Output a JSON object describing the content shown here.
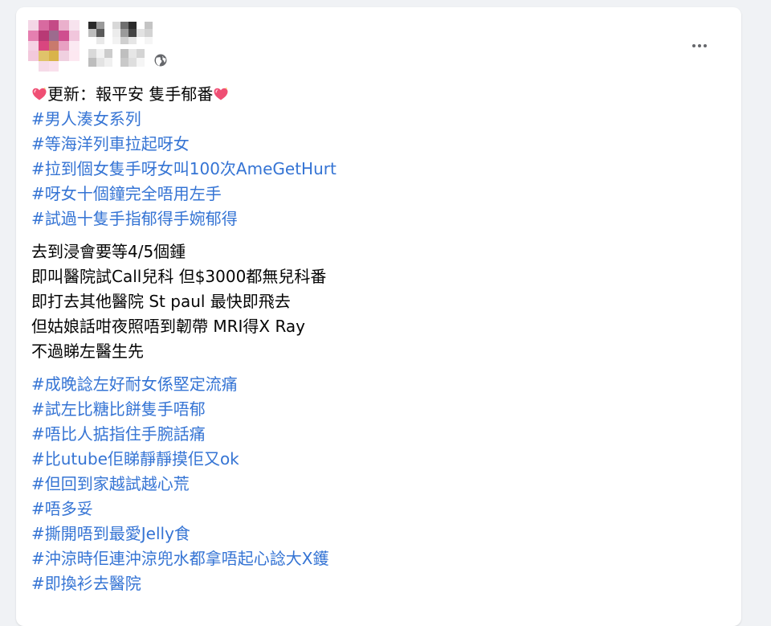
{
  "post": {
    "header": {
      "avatar_colors": [
        "#f4d7e6",
        "#d86aa0",
        "#c44a86",
        "#eab0cc",
        "#f7e3ee",
        "#e57fb0",
        "#b83a75",
        "#9c6b8e",
        "#cf4f8f",
        "#f1c6dc",
        "#f5d2e4",
        "#d9467f",
        "#c97a6d",
        "#e8a0c2",
        "#fbe9f2",
        "#f3c9dc",
        "#e0c36a",
        "#d9b44a",
        "#f0d0e0",
        "#fde8f1",
        "#ffffff",
        "#f6dbe8",
        "#f9e0ec",
        "#ffffff",
        "#ffffff"
      ],
      "name_colors": [
        "#2a2a2a",
        "#9a9a9a",
        "#ffffff",
        "#d8d8d8",
        "#6f6f6f",
        "#2b2b2b",
        "#ffffff",
        "#c4c4c4",
        "#bdbdbd",
        "#5a5a5a",
        "#ffffff",
        "#ececec",
        "#9a9a9a",
        "#444444",
        "#e2e2e2",
        "#d3d3d3",
        "#ffffff",
        "#e9e9e9",
        "#ffffff",
        "#f2f2f2",
        "#cfcfcf",
        "#e6e6e6",
        "#ffffff",
        "#f5f5f5"
      ],
      "meta_colors": [
        "#d9d9d9",
        "#f2f2f2",
        "#cccccc",
        "#ffffff",
        "#bfbfbf",
        "#e6e6e6",
        "#d4d4d4",
        "#bdbdbd",
        "#e3e3e3",
        "#f0f0f0",
        "#ffffff",
        "#c9c9c9",
        "#dedede",
        "#f5f5f5"
      ],
      "privacy_icon": "globe-icon",
      "menu_icon": "more-horizontal-icon"
    },
    "title": {
      "icon": "sparkling-heart-emoji",
      "text": "更新：報平安 隻手郁番"
    },
    "hashtags_1": [
      "#男人湊女系列",
      "#等海洋列車拉起呀女",
      "#拉到個女隻手呀女叫100次AmeGetHurt",
      "#呀女十個鐘完全唔用左手",
      "#試過十隻手指郁得手婉郁得"
    ],
    "body_lines": [
      "去到浸會要等4/5個鍾",
      "即叫醫院試Call兒科 但$3000都無兒科番",
      "即打去其他醫院 St paul 最快即飛去",
      "但姑娘話咁夜照唔到韌帶 MRI得X Ray",
      "不過睇左醫生先"
    ],
    "hashtags_2": [
      "#成晚諗左好耐女係堅定流痛",
      "#試左比糖比餅隻手唔郁",
      "#唔比人掂指住手腕話痛",
      "#比utube佢睇靜靜摸佢又ok",
      "#但回到家越試越心荒",
      "#唔多妥",
      "#撕開唔到最愛Jelly食",
      "#沖涼時佢連沖涼兜水都拿唔起心諗大X鑊",
      "#即換衫去醫院"
    ],
    "colors": {
      "hashtag": "#3574d4",
      "text": "#050505",
      "card_bg": "#ffffff",
      "page_bg": "#f0f2f5"
    }
  }
}
